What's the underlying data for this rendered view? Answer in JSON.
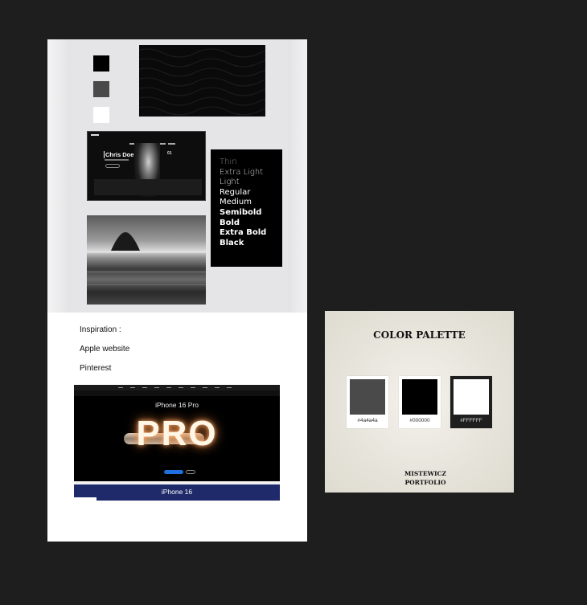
{
  "board": {
    "swatch_colors": [
      "#000000",
      "#4a4a4a",
      "#ffffff"
    ],
    "site_thumbnail": {
      "hero_name": "Chris Doe",
      "stat": "01"
    },
    "font_weights": [
      "Thin",
      "Extra Light",
      "Light",
      "Regular",
      "Medium",
      "Semibold",
      "Bold",
      "Extra Bold",
      "Black"
    ],
    "inspiration": {
      "heading": "Inspiration :",
      "items": [
        "Apple website",
        "Pinterest"
      ]
    },
    "apple_screenshot": {
      "title": "iPhone 16 Pro",
      "hero_word": "PRO",
      "lower_title": "iPhone 16"
    }
  },
  "palette": {
    "title": "COLOR PALETTE",
    "chips": [
      {
        "color": "#4a4a4a",
        "code": "#4a4a4a"
      },
      {
        "color": "#000000",
        "code": "#000000"
      },
      {
        "color": "#FFFFFF",
        "code": "#FFFFFF"
      }
    ],
    "footer_line1": "MISTEWICZ",
    "footer_line2": "PORTFOLIO"
  }
}
